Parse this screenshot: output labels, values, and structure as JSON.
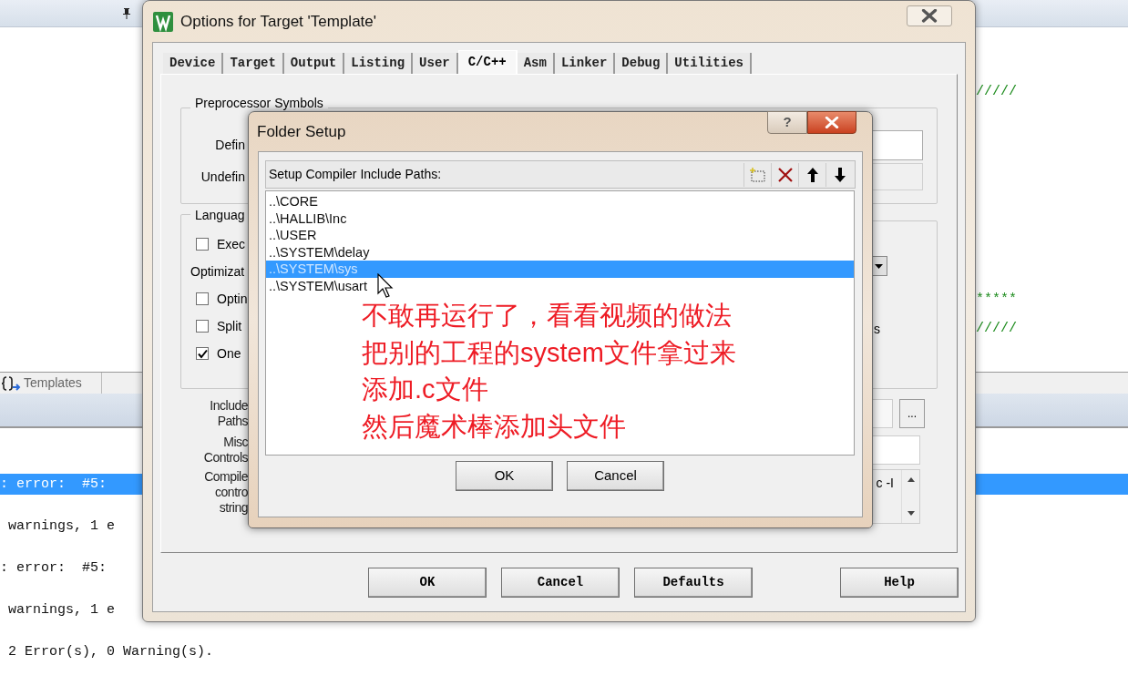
{
  "ide": {
    "tab": "Templates",
    "code_marks": [
      "/////",
      "*****",
      "/////"
    ],
    "output_lines": [
      {
        "text": ": error:  #5:",
        "selected": true
      },
      {
        "text": " warnings, 1 e",
        "selected": false
      },
      {
        "text": ": error:  #5:",
        "selected": false
      },
      {
        "text": " warnings, 1 e",
        "selected": false
      },
      {
        "text": " 2 Error(s), 0 Warning(s).",
        "selected": false
      }
    ]
  },
  "options_dialog": {
    "title": "Options for Target 'Template'",
    "tabs": [
      {
        "label": "Device",
        "selected": false
      },
      {
        "label": "Target",
        "selected": false
      },
      {
        "label": "Output",
        "selected": false
      },
      {
        "label": "Listing",
        "selected": false
      },
      {
        "label": "User",
        "selected": false
      },
      {
        "label": "C/C++",
        "selected": true
      },
      {
        "label": "Asm",
        "selected": false
      },
      {
        "label": "Linker",
        "selected": false
      },
      {
        "label": "Debug",
        "selected": false
      },
      {
        "label": "Utilities",
        "selected": false
      }
    ],
    "preprocessor": {
      "title": "Preprocessor Symbols",
      "define_label": "Defin",
      "undefine_label": "Undefin"
    },
    "language": {
      "title": "Languag",
      "execute_only": {
        "label": "Exec",
        "checked": false
      },
      "optimization_label": "Optimizat",
      "options": [
        {
          "label": "Optin",
          "checked": false
        },
        {
          "label": "Split",
          "checked": false
        },
        {
          "label": "One",
          "checked": true
        }
      ],
      "side_label": "s"
    },
    "include_label": [
      "Include",
      "Paths"
    ],
    "misc_label": [
      "Misc",
      "Controls"
    ],
    "compiler_label": [
      "Compile",
      "contro",
      "string"
    ],
    "browse_button": "...",
    "compiler_string": "c -I",
    "buttons": [
      "OK",
      "Cancel",
      "Defaults",
      "Help"
    ]
  },
  "folder_dialog": {
    "title": "Folder Setup",
    "help_button": "?",
    "header": "Setup Compiler Include Paths:",
    "paths": [
      {
        "text": "..\\CORE",
        "selected": false
      },
      {
        "text": "..\\HALLIB\\Inc",
        "selected": false
      },
      {
        "text": "..\\USER",
        "selected": false
      },
      {
        "text": "..\\SYSTEM\\delay",
        "selected": false
      },
      {
        "text": "..\\SYSTEM\\sys",
        "selected": true
      },
      {
        "text": "..\\SYSTEM\\usart",
        "selected": false
      }
    ],
    "buttons": [
      "OK",
      "Cancel"
    ]
  },
  "annotation": [
    "不敢再运行了，看看视频的做法",
    "把别的工程的system文件拿过来",
    "添加.c文件",
    "然后魔术棒添加头文件"
  ]
}
